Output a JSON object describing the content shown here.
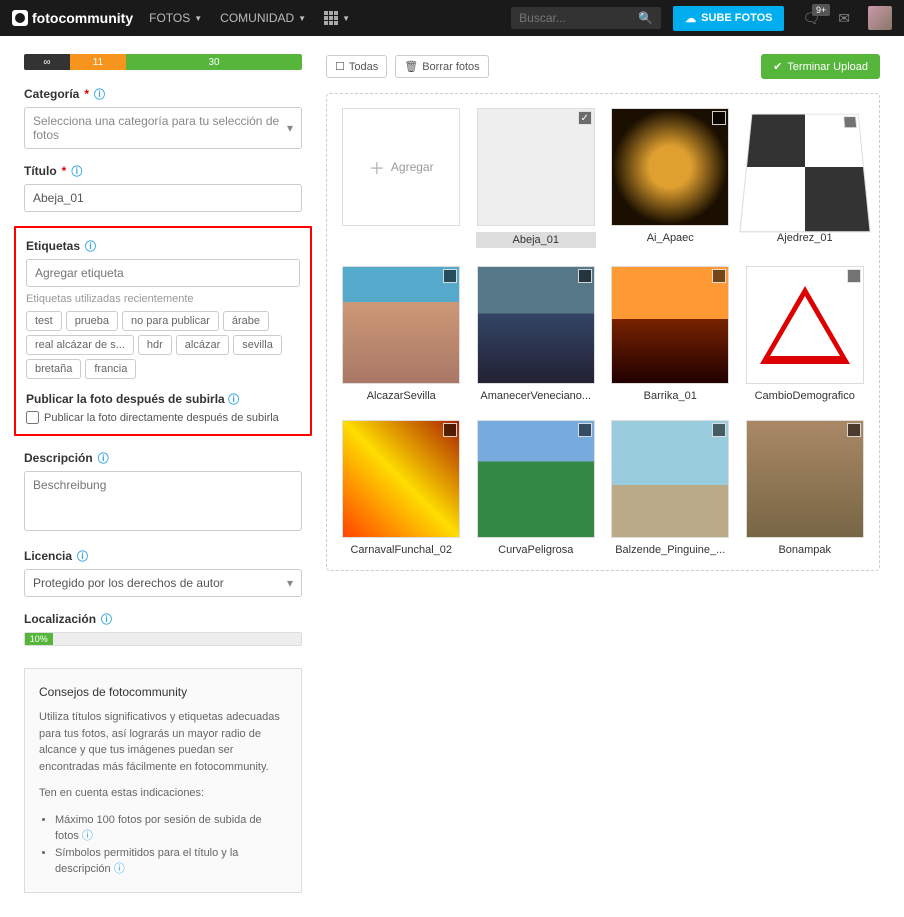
{
  "nav": {
    "fotos": "FOTOS",
    "comunidad": "COMUNIDAD",
    "search_ph": "Buscar...",
    "upload": "SUBE FOTOS",
    "notif": "9+"
  },
  "progress": {
    "a": "∞",
    "b": "11",
    "c": "30"
  },
  "form": {
    "categoria_lbl": "Categoría",
    "categoria_ph": "Selecciona una categoría para tu selección de fotos",
    "titulo_lbl": "Título",
    "titulo_val": "Abeja_01",
    "etiquetas_lbl": "Etiquetas",
    "etiquetas_ph": "Agregar etiqueta",
    "recent_lbl": "Etiquetas utilizadas recientemente",
    "tags": [
      "test",
      "prueba",
      "no para publicar",
      "árabe",
      "real alcázar de s...",
      "hdr",
      "alcázar",
      "sevilla",
      "bretaña",
      "francia"
    ],
    "pub_h": "Publicar la foto después de subirla",
    "pub_chk": "Publicar la foto directamente después de subirla",
    "desc_lbl": "Descripción",
    "desc_ph": "Beschreibung",
    "lic_lbl": "Licencia",
    "lic_val": "Protegido por los derechos de autor",
    "loc_lbl": "Localización",
    "loc_pct": "10%"
  },
  "tips": {
    "h": "Consejos de fotocommunity",
    "p": "Utiliza títulos significativos y etiquetas adecuadas para tus fotos, así lograrás un mayor radio de alcance y que tus imágenes puedan ser encontradas más fácilmente en fotocommunity.",
    "p2": "Ten en cuenta estas indicaciones:",
    "li1": "Máximo 100 fotos por sesión de subida de fotos",
    "li2": "Símbolos permitidos para el título y la descripción"
  },
  "toolbar": {
    "todas": "Todas",
    "borrar": "Borrar fotos",
    "finish": "Terminar Upload"
  },
  "gallery": {
    "add": "Agregar",
    "items": [
      "Abeja_01",
      "Ai_Apaec",
      "Ajedrez_01",
      "AlcazarSevilla",
      "AmanecerVeneciano...",
      "Barrika_01",
      "CambioDemografico",
      "CarnavalFunchal_02",
      "CurvaPeligrosa",
      "Balzende_Pinguine_...",
      "Bonampak"
    ]
  }
}
